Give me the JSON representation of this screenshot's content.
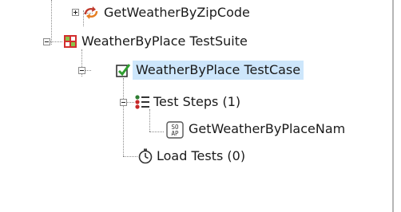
{
  "tree": {
    "operation_top": {
      "label": "GetWeatherByZipCode"
    },
    "suite": {
      "label": "WeatherByPlace TestSuite"
    },
    "testcase": {
      "label": "WeatherByPlace TestCase"
    },
    "steps": {
      "label": "Test Steps (1)"
    },
    "step1": {
      "label": "GetWeatherByPlaceNam"
    },
    "loadtests": {
      "label": "Load Tests (0)"
    }
  }
}
